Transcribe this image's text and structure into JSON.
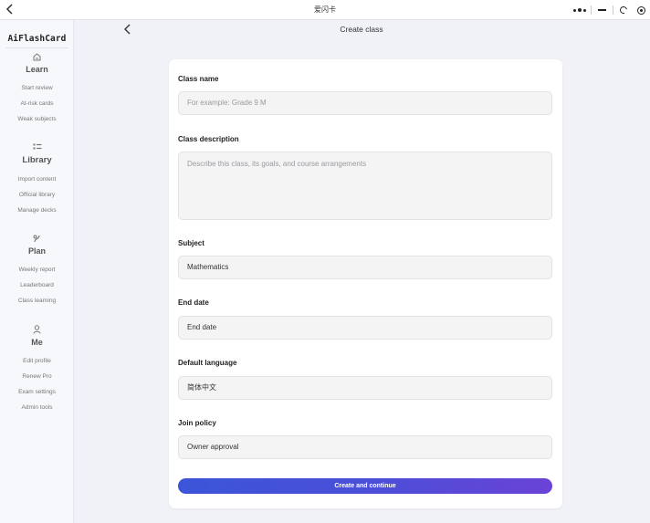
{
  "window": {
    "title": "爱闪卡"
  },
  "sidebar": {
    "brand": "AiFlashCard",
    "sections": [
      {
        "title": "Learn",
        "icon": "home-icon",
        "items": [
          "Start review",
          "At-risk cards",
          "Weak subjects"
        ]
      },
      {
        "title": "Library",
        "icon": "list-icon",
        "items": [
          "Import content",
          "Official library",
          "Manage decks"
        ]
      },
      {
        "title": "Plan",
        "icon": "plan-icon",
        "items": [
          "Weekly report",
          "Leaderboard",
          "Class learning"
        ]
      },
      {
        "title": "Me",
        "icon": "user-icon",
        "items": [
          "Edit profile",
          "Renew Pro",
          "Exam settings",
          "Admin tools"
        ]
      }
    ]
  },
  "page": {
    "title": "Create class"
  },
  "form": {
    "class_name": {
      "label": "Class name",
      "placeholder": "For example: Grade 9 M"
    },
    "class_description": {
      "label": "Class description",
      "placeholder": "Describe this class, its goals, and course arrangements"
    },
    "subject": {
      "label": "Subject",
      "value": "Mathematics"
    },
    "end_date": {
      "label": "End date",
      "value": "End date"
    },
    "default_language": {
      "label": "Default language",
      "value": "简体中文"
    },
    "join_policy": {
      "label": "Join policy",
      "value": "Owner approval"
    },
    "submit_label": "Create and continue"
  },
  "colors": {
    "accent_start": "#3b55d9",
    "accent_end": "#6a43d6",
    "page_bg": "#f1f2f7",
    "card_bg": "#ffffff"
  }
}
